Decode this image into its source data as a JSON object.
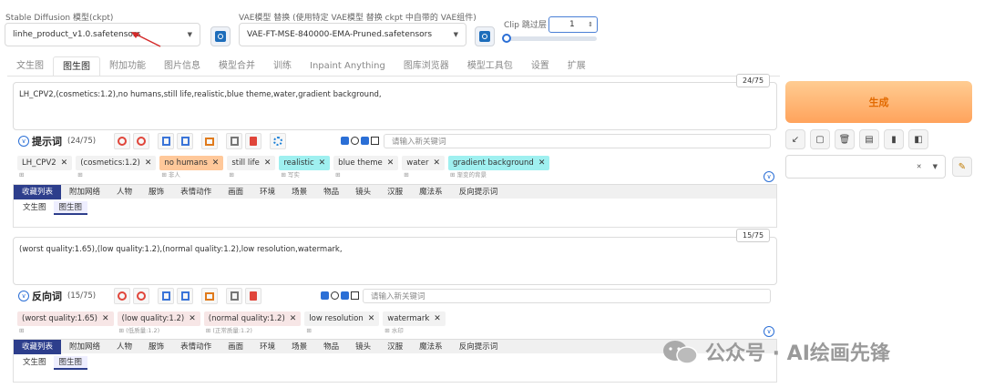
{
  "header": {
    "sd_label": "Stable Diffusion 模型(ckpt)",
    "sd_value": "linhe_product_v1.0.safetensors",
    "vae_label": "VAE模型 替换 (使用特定 VAE模型 替换 ckpt 中自带的 VAE组件)",
    "vae_value": "VAE-FT-MSE-840000-EMA-Pruned.safetensors",
    "clip_label": "Clip 跳过层",
    "clip_value": "1",
    "clip_slider_fraction": 0
  },
  "tabs": [
    "文生图",
    "图生图",
    "附加功能",
    "图片信息",
    "模型合并",
    "训练",
    "Inpaint Anything",
    "图库浏览器",
    "模型工具包",
    "设置",
    "扩展"
  ],
  "active_tab": 1,
  "prompt": {
    "text": "LH_CPV2,(cosmetics:1.2),no humans,still life,realistic,blue theme,water,gradient background,",
    "counter": "24/75",
    "title": "提示词",
    "count": "(24/75)",
    "kw_placeholder": "请输入新关键词",
    "tags": [
      {
        "label": "LH_CPV2",
        "sub": "",
        "color": "#f2f2f2"
      },
      {
        "label": "(cosmetics:1.2)",
        "sub": "",
        "color": "#f2f2f2"
      },
      {
        "label": "no humans",
        "sub": "非人",
        "color": "#ffc89a"
      },
      {
        "label": "still life",
        "sub": "",
        "color": "#f2f2f2"
      },
      {
        "label": "realistic",
        "sub": "写实",
        "color": "#9ff0f0"
      },
      {
        "label": "blue theme",
        "sub": "",
        "color": "#f2f2f2"
      },
      {
        "label": "water",
        "sub": "",
        "color": "#f2f2f2"
      },
      {
        "label": "gradient background",
        "sub": "渐变的背景",
        "color": "#9ff0f0"
      }
    ]
  },
  "negative": {
    "text": "(worst quality:1.65),(low quality:1.2),(normal quality:1.2),low resolution,watermark,",
    "counter": "15/75",
    "title": "反向词",
    "count": "(15/75)",
    "kw_placeholder": "请输入新关键词",
    "tags": [
      {
        "label": "(worst quality:1.65)",
        "sub": "",
        "color": "#f7e6e6"
      },
      {
        "label": "(low quality:1.2)",
        "sub": "(低质量:1.2)",
        "color": "#f7e6e6"
      },
      {
        "label": "(normal quality:1.2)",
        "sub": "(正常质量:1.2)",
        "color": "#f7e6e6"
      },
      {
        "label": "low resolution",
        "sub": "",
        "color": "#f2f2f2"
      },
      {
        "label": "watermark",
        "sub": "水印",
        "color": "#f2f2f2"
      }
    ]
  },
  "categories": [
    "收藏列表",
    "附加网络",
    "人物",
    "服饰",
    "表情动作",
    "画面",
    "环境",
    "场景",
    "物品",
    "镜头",
    "汉服",
    "魔法系",
    "反向提示词"
  ],
  "subtabs": [
    "文生图",
    "图生图"
  ],
  "generate_label": "生成",
  "toolbar_icons": [
    "arrow-icon",
    "square-icon",
    "trash-icon",
    "clipboard-icon",
    "tube-icon",
    "box-icon"
  ],
  "watermark": "公众号 · AI绘画先锋"
}
